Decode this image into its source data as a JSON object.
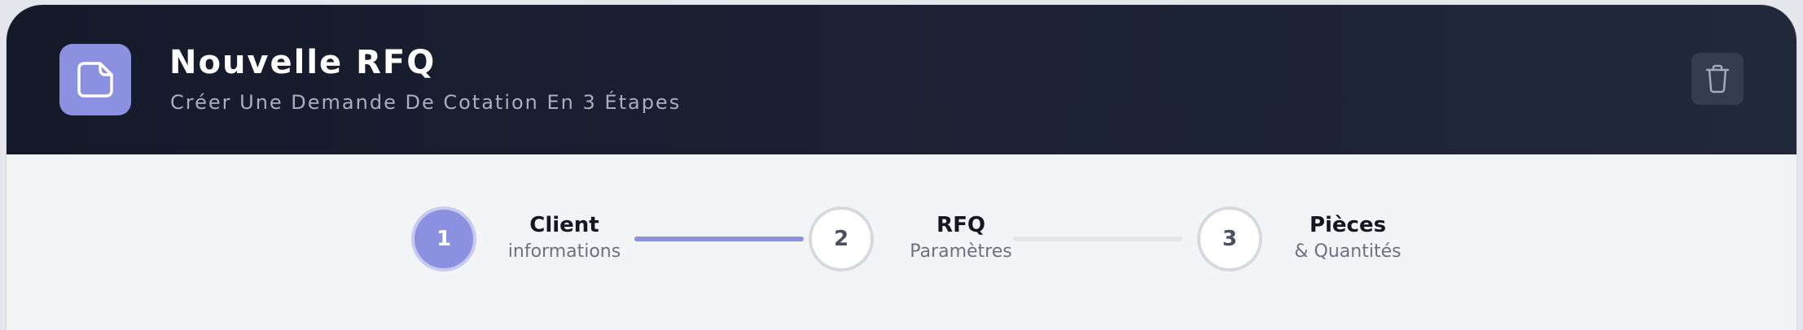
{
  "header": {
    "title": "Nouvelle RFQ",
    "subtitle": "Créer Une Demande De Cotation En 3 Étapes",
    "icon": "document-icon",
    "action_icon": "trash-icon"
  },
  "stepper": {
    "steps": [
      {
        "number": "1",
        "label": "Client",
        "sub": "informations",
        "state": "active"
      },
      {
        "number": "2",
        "label": "RFQ",
        "sub": "Paramètres",
        "state": "pending"
      },
      {
        "number": "3",
        "label": "Pièces",
        "sub": "& Quantités",
        "state": "pending"
      }
    ],
    "connectors": [
      {
        "state": "complete",
        "color": "#8b90e0"
      },
      {
        "state": "incomplete",
        "color": "#e4e5e9"
      }
    ]
  },
  "colors": {
    "accent": "#8b90e0",
    "header_bg": "#141a2a"
  }
}
